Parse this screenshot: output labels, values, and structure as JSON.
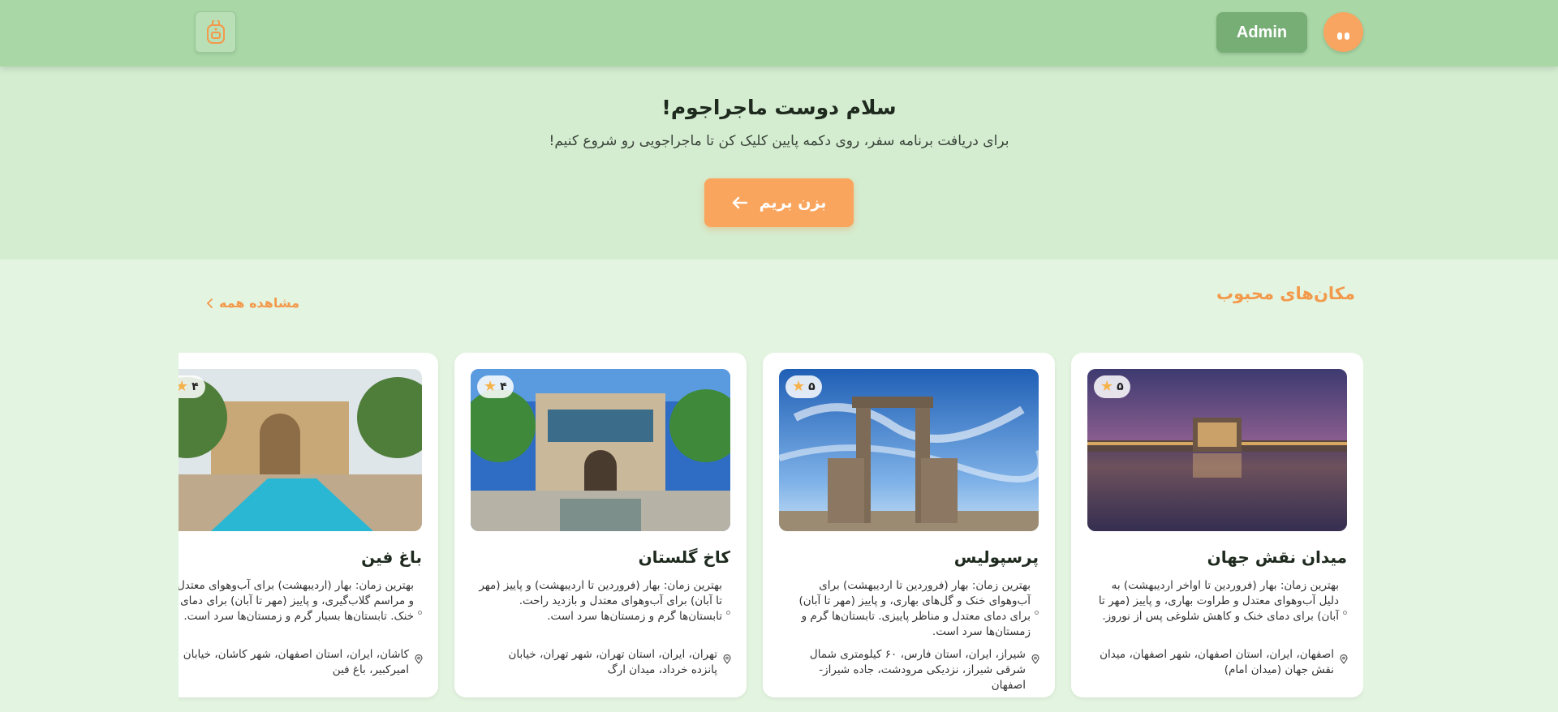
{
  "header": {
    "admin_label": "Admin",
    "avatar_icon": "smiley-avatar-icon",
    "logo_icon": "backpack-icon",
    "colors": {
      "bar": "#a9d8a6",
      "admin": "#77ae76",
      "avatar": "#f7a560"
    }
  },
  "hero": {
    "title": "سلام دوست ماجراجوم!",
    "subtitle": "برای دریافت برنامه سفر، روی دکمه پایین کلیک کن تا ماجراجویی رو شروع کنیم!",
    "cta_label": "بزن بریم",
    "cta_icon": "arrow-left-icon",
    "colors": {
      "cta": "#f9a55d"
    }
  },
  "places": {
    "title": "مکان‌های محبوب",
    "see_all": "مشاهده همه",
    "accent": "#f3994b",
    "cards": [
      {
        "name": "میدان نقش جهان",
        "rating": "۵",
        "desc": "بهترین زمان: بهار (فروردین تا اواخر اردیبهشت) به دلیل آب‌وهوای معتدل و طراوت بهاری، و پاییز (مهر تا آبان) برای دمای خنک و کاهش شلوغی پس از نوروز.",
        "location": "اصفهان، ایران، استان اصفهان، شهر اصفهان، میدان نقش جهان (میدان امام)"
      },
      {
        "name": "پرسپولیس",
        "rating": "۵",
        "desc": "بهترین زمان: بهار (فروردین تا اردیبهشت) برای آب‌وهوای خنک و گل‌های بهاری، و پاییز (مهر تا آبان) برای دمای معتدل و مناظر پاییزی. تابستان‌ها گرم و زمستان‌ها سرد است.",
        "location": "شیراز، ایران، استان فارس، ۶۰ کیلومتری شمال شرقی شیراز، نزدیکی مرودشت، جاده شیراز-اصفهان"
      },
      {
        "name": "کاخ گلستان",
        "rating": "۴",
        "desc": "بهترین زمان: بهار (فروردین تا اردیبهشت) و پاییز (مهر تا آبان) برای آب‌وهوای معتدل و بازدید راحت. تابستان‌ها گرم و زمستان‌ها سرد است.",
        "location": "تهران، ایران، استان تهران، شهر تهران، خیابان پانزده خرداد، میدان ارگ"
      },
      {
        "name": "باغ فین",
        "rating": "۴",
        "desc": "بهترین زمان: بهار (اردیبهشت) برای آب‌وهوای معتدل و مراسم گلاب‌گیری، و پاییز (مهر تا آبان) برای دمای خنک. تابستان‌ها بسیار گرم و زمستان‌ها سرد است.",
        "location": "کاشان، ایران، استان اصفهان، شهر کاشان، خیابان امیرکبیر، باغ فین"
      }
    ]
  }
}
